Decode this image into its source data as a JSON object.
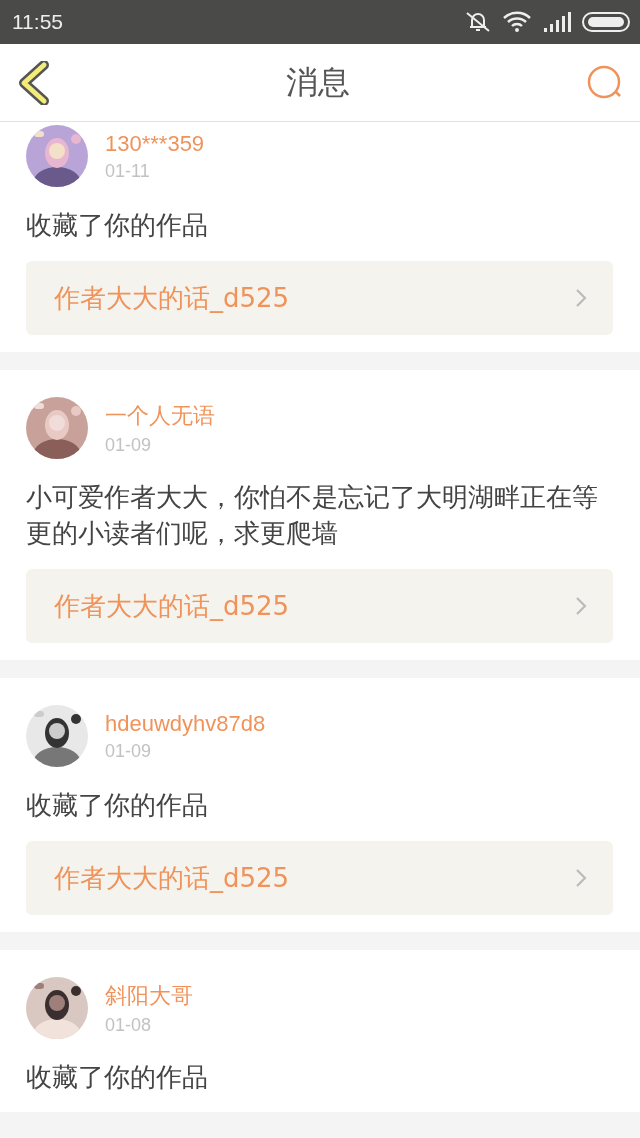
{
  "status_bar": {
    "time": "11:55"
  },
  "header": {
    "title": "消息"
  },
  "messages": [
    {
      "name": "130***359",
      "date": "01-11",
      "text": "收藏了你的作品",
      "link": "作者大大的话_d525"
    },
    {
      "name": "一个人无语",
      "date": "01-09",
      "text": "小可爱作者大大，你怕不是忘记了大明湖畔正在等更的小读者们呢，求更爬墙",
      "link": "作者大大的话_d525"
    },
    {
      "name": "hdeuwdyhv87d8",
      "date": "01-09",
      "text": "收藏了你的作品",
      "link": "作者大大的话_d525"
    },
    {
      "name": "斜阳大哥",
      "date": "01-08",
      "text": "收藏了你的作品"
    }
  ]
}
